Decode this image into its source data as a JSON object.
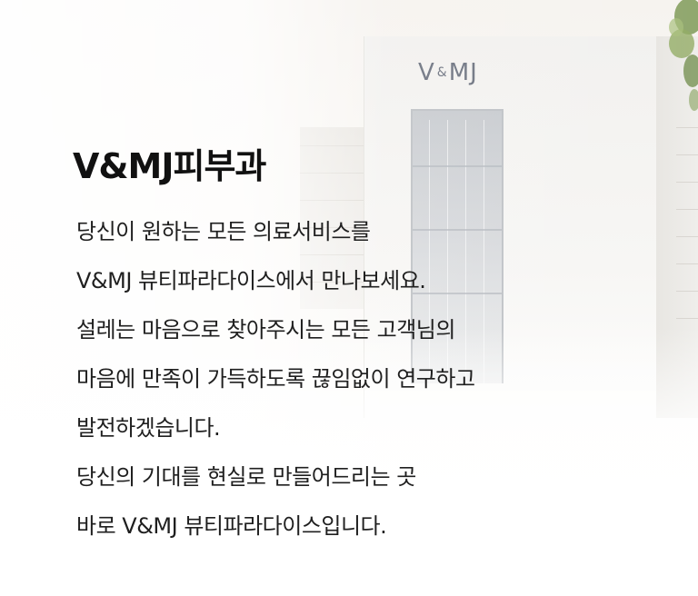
{
  "logo": {
    "main": "V",
    "amp": "&",
    "tail": "MJ"
  },
  "heading": {
    "title": "V&MJ피부과"
  },
  "description": {
    "lines": [
      "당신이 원하는 모든 의료서비스를",
      "V&MJ 뷰티파라다이스에서 만나보세요.",
      "설레는 마음으로 찾아주시는 모든 고객님의",
      "마음에 만족이 가득하도록 끊임없이 연구하고",
      "발전하겠습니다.",
      "당신의 기대를 현실로 만들어드리는 곳",
      "바로 V&MJ 뷰티파라다이스입니다."
    ]
  },
  "colors": {
    "text": "#1f1f1f",
    "title": "#111111",
    "logo": "#6d7380",
    "background": "#ffffff"
  }
}
